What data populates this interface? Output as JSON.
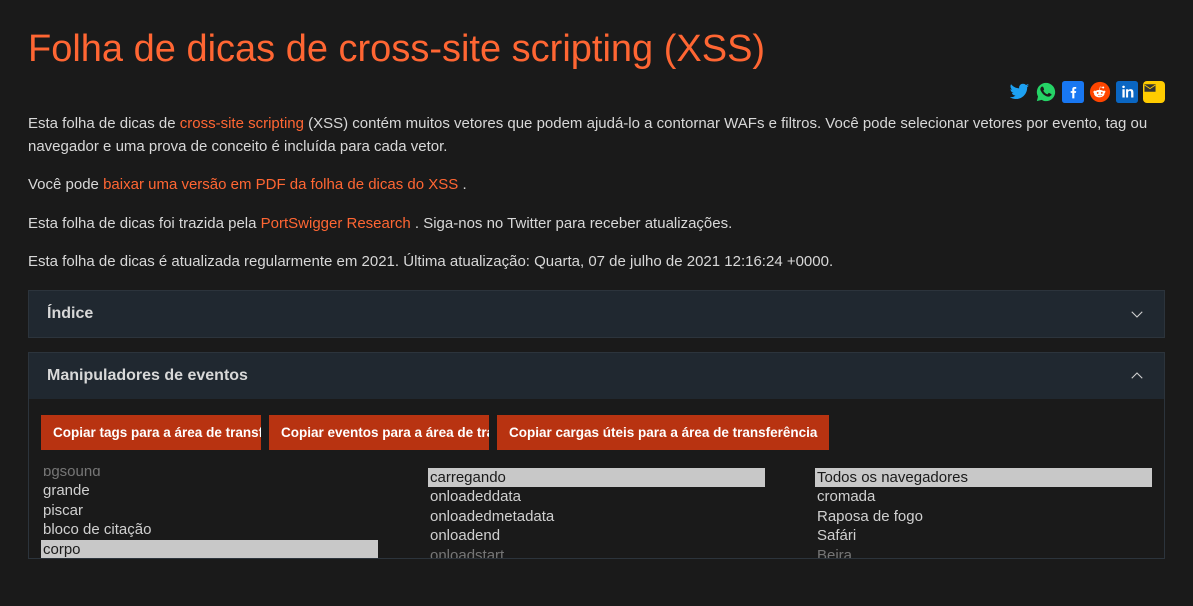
{
  "title": "Folha de dicas de cross-site scripting (XSS)",
  "intro": {
    "p1_a": "Esta folha de dicas de ",
    "p1_link": "cross-site scripting",
    "p1_b": " (XSS) contém muitos vetores que podem ajudá-lo a contornar WAFs e filtros. Você pode selecionar vetores por evento, tag ou navegador e uma prova de conceito é incluída para cada vetor.",
    "p2_a": "Você pode ",
    "p2_link": "baixar uma versão em PDF da folha de dicas do XSS ",
    "p2_b": ".",
    "p3_a": "Esta folha de dicas foi trazida pela ",
    "p3_link": "PortSwigger Research ",
    "p3_b": ". Siga-nos no Twitter para receber atualizações.",
    "p4": "Esta folha de dicas é atualizada regularmente em 2021. Última atualização: Quarta, 07 de julho de 2021 12:16:24 +0000."
  },
  "panels": {
    "index_title": "Índice",
    "handlers_title": "Manipuladores de eventos"
  },
  "buttons": {
    "copy_tags": "Copiar tags para a área de transferência",
    "copy_events": "Copiar eventos para a área de transferência",
    "copy_payloads": "Copiar cargas úteis para a área de transferência"
  },
  "list_tags": {
    "i0": "bgsound",
    "i1": "grande",
    "i2": "piscar",
    "i3": "bloco de citação",
    "i4": "corpo"
  },
  "list_events": {
    "i0": "carregando",
    "i1": "onloadeddata",
    "i2": "onloadedmetadata",
    "i3": "onloadend",
    "i4": "onloadstart"
  },
  "list_browsers": {
    "i0": "Todos os navegadores",
    "i1": "cromada",
    "i2": "Raposa de fogo",
    "i3": "Safári",
    "i4": "Beira"
  }
}
